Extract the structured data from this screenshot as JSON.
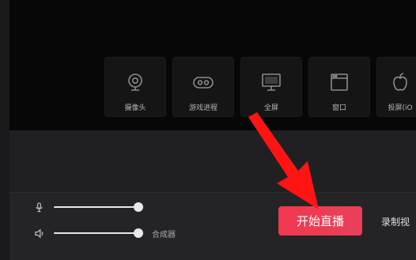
{
  "sources": [
    {
      "label": "摄像头",
      "icon": "webcam-icon"
    },
    {
      "label": "游戏进程",
      "icon": "gamepad-icon"
    },
    {
      "label": "全屏",
      "icon": "monitor-icon"
    },
    {
      "label": "窗口",
      "icon": "window-icon"
    },
    {
      "label": "投屏(iO",
      "icon": "apple-icon"
    }
  ],
  "audio": {
    "mic_icon": "microphone-icon",
    "speaker_icon": "speaker-icon",
    "mixer_label": "合成器",
    "mic_level": 1.0,
    "speaker_level": 1.0
  },
  "actions": {
    "start_live": "开始直播",
    "record_video": "录制视"
  },
  "colors": {
    "start_button": "#f0384e",
    "annotation_arrow": "#ff1414",
    "background": "#202022",
    "preview": "#070707"
  }
}
